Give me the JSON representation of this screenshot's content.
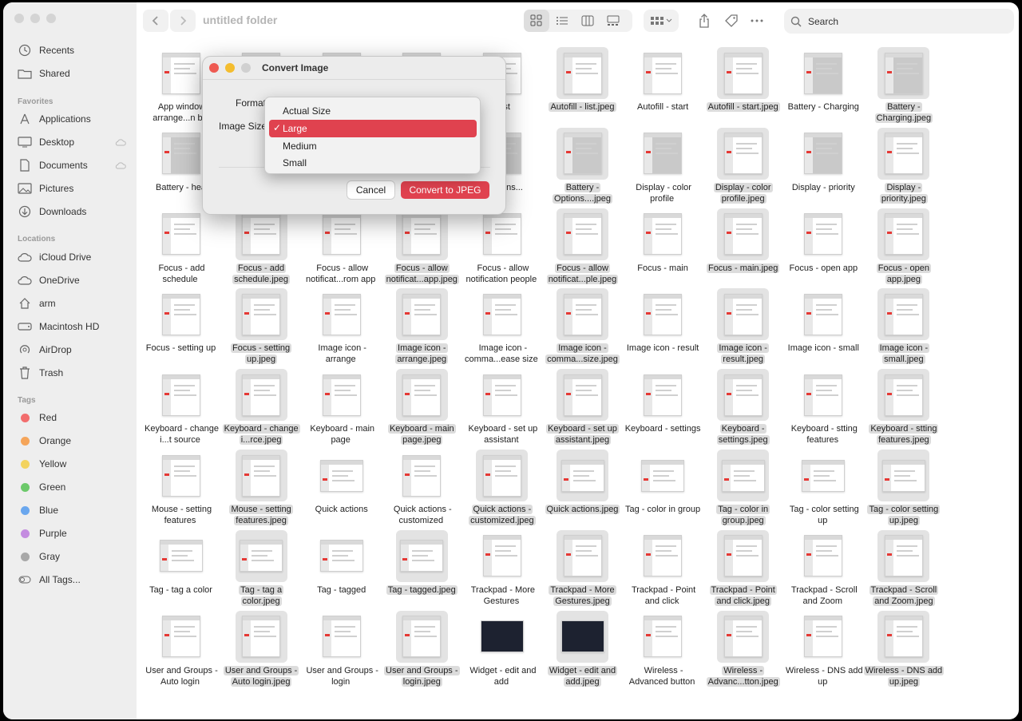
{
  "toolbar": {
    "title": "untitled folder",
    "search_placeholder": "Search"
  },
  "sidebar": {
    "items_top": [
      {
        "label": "Recents",
        "icon": "clock-icon"
      },
      {
        "label": "Shared",
        "icon": "shared-folder-icon"
      }
    ],
    "favorites_header": "Favorites",
    "favorites": [
      {
        "label": "Applications",
        "icon": "applications-icon"
      },
      {
        "label": "Desktop",
        "icon": "desktop-icon",
        "cloud": true
      },
      {
        "label": "Documents",
        "icon": "document-icon",
        "cloud": true
      },
      {
        "label": "Pictures",
        "icon": "photo-icon"
      },
      {
        "label": "Downloads",
        "icon": "download-icon"
      }
    ],
    "locations_header": "Locations",
    "locations": [
      {
        "label": "iCloud Drive",
        "icon": "cloud-icon"
      },
      {
        "label": "OneDrive",
        "icon": "cloud-icon"
      },
      {
        "label": "arm",
        "icon": "home-icon"
      },
      {
        "label": "Macintosh HD",
        "icon": "disk-icon"
      },
      {
        "label": "AirDrop",
        "icon": "airdrop-icon"
      },
      {
        "label": "Trash",
        "icon": "trash-icon"
      }
    ],
    "tags_header": "Tags",
    "tags": [
      {
        "label": "Red",
        "color": "#f26d6d"
      },
      {
        "label": "Orange",
        "color": "#f5a55a"
      },
      {
        "label": "Yellow",
        "color": "#f3d35f"
      },
      {
        "label": "Green",
        "color": "#6cc96a"
      },
      {
        "label": "Blue",
        "color": "#6aa7ee"
      },
      {
        "label": "Purple",
        "color": "#c48ce0"
      },
      {
        "label": "Gray",
        "color": "#a8a8a8"
      },
      {
        "label": "All Tags...",
        "color": ""
      }
    ]
  },
  "dialog": {
    "title": "Convert Image",
    "format_label": "Format",
    "size_label": "Image Size",
    "cancel": "Cancel",
    "convert": "Convert to JPEG",
    "options": [
      "Actual Size",
      "Large",
      "Medium",
      "Small"
    ],
    "selected": "Large"
  },
  "files": [
    {
      "name": "App window arrange...n bu",
      "sel": false
    },
    {
      "name": "",
      "sel": false
    },
    {
      "name": "",
      "sel": false
    },
    {
      "name": "",
      "sel": false
    },
    {
      "name": "- list",
      "sel": false
    },
    {
      "name": "Autofill - list.jpeg",
      "sel": true
    },
    {
      "name": "Autofill - start",
      "sel": false
    },
    {
      "name": "Autofill - start.jpeg",
      "sel": true
    },
    {
      "name": "Battery - Charging",
      "sel": false
    },
    {
      "name": "Battery - Charging.jpeg",
      "sel": true
    },
    {
      "name": "Battery - hea",
      "sel": false
    },
    {
      "name": "",
      "sel": false
    },
    {
      "name": "",
      "sel": false
    },
    {
      "name": "",
      "sel": false
    },
    {
      "name": "ery - ons...",
      "sel": false
    },
    {
      "name": "Battery - Options....jpeg",
      "sel": true
    },
    {
      "name": "Display - color profile",
      "sel": false
    },
    {
      "name": "Display - color profile.jpeg",
      "sel": true
    },
    {
      "name": "Display - priority",
      "sel": false
    },
    {
      "name": "Display - priority.jpeg",
      "sel": true
    },
    {
      "name": "Focus - add schedule",
      "sel": false
    },
    {
      "name": "Focus - add schedule.jpeg",
      "sel": true
    },
    {
      "name": "Focus - allow notificat...rom app",
      "sel": false
    },
    {
      "name": "Focus - allow notificat...app.jpeg",
      "sel": true
    },
    {
      "name": "Focus - allow notification people",
      "sel": false
    },
    {
      "name": "Focus - allow notificat...ple.jpeg",
      "sel": true
    },
    {
      "name": "Focus - main",
      "sel": false
    },
    {
      "name": "Focus - main.jpeg",
      "sel": true
    },
    {
      "name": "Focus - open app",
      "sel": false
    },
    {
      "name": "Focus - open app.jpeg",
      "sel": true
    },
    {
      "name": "Focus - setting up",
      "sel": false
    },
    {
      "name": "Focus - setting up.jpeg",
      "sel": true
    },
    {
      "name": "Image icon - arrange",
      "sel": false
    },
    {
      "name": "Image icon - arrange.jpeg",
      "sel": true
    },
    {
      "name": "Image icon - comma...ease size",
      "sel": false
    },
    {
      "name": "Image icon - comma...size.jpeg",
      "sel": true
    },
    {
      "name": "Image icon - result",
      "sel": false
    },
    {
      "name": "Image icon - result.jpeg",
      "sel": true
    },
    {
      "name": "Image icon - small",
      "sel": false
    },
    {
      "name": "Image icon - small.jpeg",
      "sel": true
    },
    {
      "name": "Keyboard - change i...t source",
      "sel": false
    },
    {
      "name": "Keyboard - change i...rce.jpeg",
      "sel": true
    },
    {
      "name": "Keyboard - main page",
      "sel": false
    },
    {
      "name": "Keyboard - main page.jpeg",
      "sel": true
    },
    {
      "name": "Keyboard - set up assistant",
      "sel": false
    },
    {
      "name": "Keyboard - set up assistant.jpeg",
      "sel": true
    },
    {
      "name": "Keyboard - settings",
      "sel": false
    },
    {
      "name": "Keyboard - settings.jpeg",
      "sel": true
    },
    {
      "name": "Keyboard - stting features",
      "sel": false
    },
    {
      "name": "Keyboard - stting features.jpeg",
      "sel": true
    },
    {
      "name": "Mouse - setting features",
      "sel": false
    },
    {
      "name": "Mouse - setting features.jpeg",
      "sel": true
    },
    {
      "name": "Quick actions",
      "sel": false
    },
    {
      "name": "Quick actions - customized",
      "sel": false
    },
    {
      "name": "Quick actions - customized.jpeg",
      "sel": true
    },
    {
      "name": "Quick actions.jpeg",
      "sel": true
    },
    {
      "name": "Tag - color in group",
      "sel": false
    },
    {
      "name": "Tag - color in group.jpeg",
      "sel": true
    },
    {
      "name": "Tag - color setting up",
      "sel": false
    },
    {
      "name": "Tag - color setting up.jpeg",
      "sel": true
    },
    {
      "name": "Tag - tag a color",
      "sel": false
    },
    {
      "name": "Tag - tag a color.jpeg",
      "sel": true
    },
    {
      "name": "Tag - tagged",
      "sel": false
    },
    {
      "name": "Tag - tagged.jpeg",
      "sel": true
    },
    {
      "name": "Trackpad - More Gestures",
      "sel": false
    },
    {
      "name": "Trackpad - More Gestures.jpeg",
      "sel": true
    },
    {
      "name": "Trackpad - Point and click",
      "sel": false
    },
    {
      "name": "Trackpad - Point and click.jpeg",
      "sel": true
    },
    {
      "name": "Trackpad - Scroll and Zoom",
      "sel": false
    },
    {
      "name": "Trackpad - Scroll and Zoom.jpeg",
      "sel": true
    },
    {
      "name": "User and Groups - Auto login",
      "sel": false
    },
    {
      "name": "User and Groups - Auto login.jpeg",
      "sel": true
    },
    {
      "name": "User and Groups - login",
      "sel": false
    },
    {
      "name": "User and Groups - login.jpeg",
      "sel": true
    },
    {
      "name": "Widget - edit and add",
      "sel": false
    },
    {
      "name": "Widget - edit and add.jpeg",
      "sel": true
    },
    {
      "name": "Wireless - Advanced button",
      "sel": false
    },
    {
      "name": "Wireless - Advanc...tton.jpeg",
      "sel": true
    },
    {
      "name": "Wireless - DNS add up",
      "sel": false
    },
    {
      "name": "Wireless - DNS add up.jpeg",
      "sel": true
    }
  ]
}
